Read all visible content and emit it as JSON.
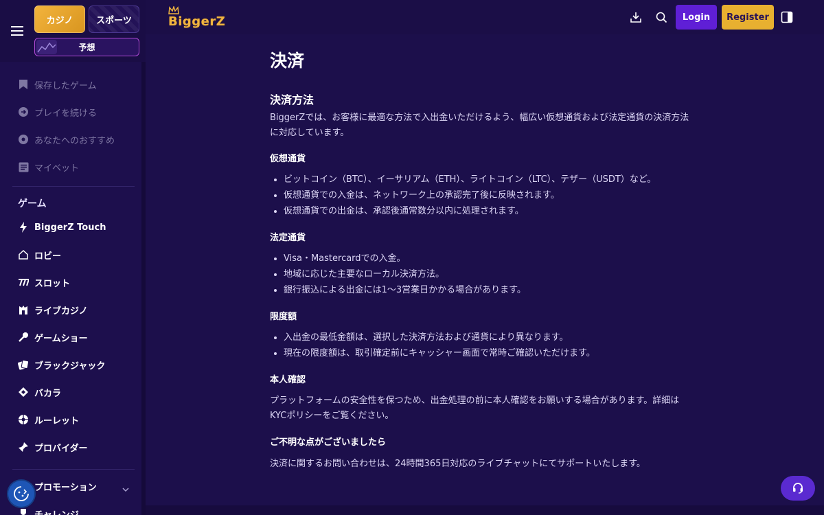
{
  "tabs": {
    "casino": "カジノ",
    "sports": "スポーツ",
    "predict": "予想"
  },
  "header": {
    "logo": "BiggerZ",
    "login": "Login",
    "register": "Register",
    "icons": [
      "download-icon",
      "search-icon",
      "panel-toggle-icon"
    ]
  },
  "sidebar": {
    "personal": [
      {
        "label": "保存したゲーム",
        "icon": "bookmark-icon"
      },
      {
        "label": "プレイを続ける",
        "icon": "play-continue-icon"
      },
      {
        "label": "あなたへのおすすめ",
        "icon": "recommend-icon"
      },
      {
        "label": "マイベット",
        "icon": "mybets-icon"
      }
    ],
    "games_heading": "ゲーム",
    "games": [
      {
        "label": "BiggerZ Touch",
        "icon": "bolt-icon"
      },
      {
        "label": "ロビー",
        "icon": "home-icon"
      },
      {
        "label": "スロット",
        "icon": "slots-icon"
      },
      {
        "label": "ライブカジノ",
        "icon": "live-casino-icon"
      },
      {
        "label": "ゲームショー",
        "icon": "microphone-icon"
      },
      {
        "label": "ブラックジャック",
        "icon": "cards-icon"
      },
      {
        "label": "バカラ",
        "icon": "baccarat-icon"
      },
      {
        "label": "ルーレット",
        "icon": "roulette-icon"
      },
      {
        "label": "プロバイダー",
        "icon": "provider-icon"
      }
    ],
    "promotions": "プロモーション",
    "challenge": "チャレンジ"
  },
  "content": {
    "title": "決済",
    "section_title": "決済方法",
    "intro": "BiggerZでは、お客様に最適な方法で入出金いただけるよう、幅広い仮想通貨および法定通貨の決済方法に対応しています。",
    "crypto_heading": "仮想通貨",
    "crypto_items": [
      "ビットコイン（BTC）、イーサリアム（ETH）、ライトコイン（LTC）、テザー（USDT）など。",
      "仮想通貨での入金は、ネットワーク上の承認完了後に反映されます。",
      "仮想通貨での出金は、承認後通常数分以内に処理されます。"
    ],
    "fiat_heading": "法定通貨",
    "fiat_items": [
      "Visa・Mastercardでの入金。",
      "地域に応じた主要なローカル決済方法。",
      "銀行振込による出金には1〜3営業日かかる場合があります。"
    ],
    "limits_heading": "限度額",
    "limits_items": [
      "入出金の最低金額は、選択した決済方法および通貨により異なります。",
      "現在の限度額は、取引確定前にキャッシャー画面で常時ご確認いただけます。"
    ],
    "kyc_heading": "本人確認",
    "kyc_text": "プラットフォームの安全性を保つため、出金処理の前に本人確認をお願いする場合があります。詳細はKYCポリシーをご覧ください。",
    "contact_heading": "ご不明な点がございましたら",
    "contact_text": "決済に関するお問い合わせは、24時間365日対応のライブチャットにてサポートいたします。"
  },
  "colors": {
    "background": "#1c0f4b",
    "accent_gold": "#e8b030",
    "accent_purple": "#5f1fd6"
  }
}
